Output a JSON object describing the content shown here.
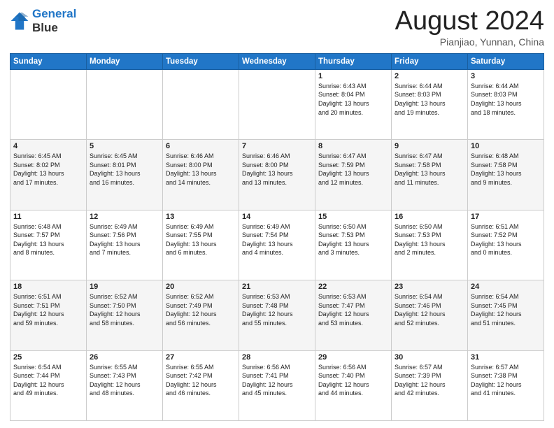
{
  "header": {
    "logo_line1": "General",
    "logo_line2": "Blue",
    "month": "August 2024",
    "location": "Pianjiao, Yunnan, China"
  },
  "weekdays": [
    "Sunday",
    "Monday",
    "Tuesday",
    "Wednesday",
    "Thursday",
    "Friday",
    "Saturday"
  ],
  "weeks": [
    [
      {
        "day": "",
        "info": ""
      },
      {
        "day": "",
        "info": ""
      },
      {
        "day": "",
        "info": ""
      },
      {
        "day": "",
        "info": ""
      },
      {
        "day": "1",
        "info": "Sunrise: 6:43 AM\nSunset: 8:04 PM\nDaylight: 13 hours\nand 20 minutes."
      },
      {
        "day": "2",
        "info": "Sunrise: 6:44 AM\nSunset: 8:03 PM\nDaylight: 13 hours\nand 19 minutes."
      },
      {
        "day": "3",
        "info": "Sunrise: 6:44 AM\nSunset: 8:03 PM\nDaylight: 13 hours\nand 18 minutes."
      }
    ],
    [
      {
        "day": "4",
        "info": "Sunrise: 6:45 AM\nSunset: 8:02 PM\nDaylight: 13 hours\nand 17 minutes."
      },
      {
        "day": "5",
        "info": "Sunrise: 6:45 AM\nSunset: 8:01 PM\nDaylight: 13 hours\nand 16 minutes."
      },
      {
        "day": "6",
        "info": "Sunrise: 6:46 AM\nSunset: 8:00 PM\nDaylight: 13 hours\nand 14 minutes."
      },
      {
        "day": "7",
        "info": "Sunrise: 6:46 AM\nSunset: 8:00 PM\nDaylight: 13 hours\nand 13 minutes."
      },
      {
        "day": "8",
        "info": "Sunrise: 6:47 AM\nSunset: 7:59 PM\nDaylight: 13 hours\nand 12 minutes."
      },
      {
        "day": "9",
        "info": "Sunrise: 6:47 AM\nSunset: 7:58 PM\nDaylight: 13 hours\nand 11 minutes."
      },
      {
        "day": "10",
        "info": "Sunrise: 6:48 AM\nSunset: 7:58 PM\nDaylight: 13 hours\nand 9 minutes."
      }
    ],
    [
      {
        "day": "11",
        "info": "Sunrise: 6:48 AM\nSunset: 7:57 PM\nDaylight: 13 hours\nand 8 minutes."
      },
      {
        "day": "12",
        "info": "Sunrise: 6:49 AM\nSunset: 7:56 PM\nDaylight: 13 hours\nand 7 minutes."
      },
      {
        "day": "13",
        "info": "Sunrise: 6:49 AM\nSunset: 7:55 PM\nDaylight: 13 hours\nand 6 minutes."
      },
      {
        "day": "14",
        "info": "Sunrise: 6:49 AM\nSunset: 7:54 PM\nDaylight: 13 hours\nand 4 minutes."
      },
      {
        "day": "15",
        "info": "Sunrise: 6:50 AM\nSunset: 7:53 PM\nDaylight: 13 hours\nand 3 minutes."
      },
      {
        "day": "16",
        "info": "Sunrise: 6:50 AM\nSunset: 7:53 PM\nDaylight: 13 hours\nand 2 minutes."
      },
      {
        "day": "17",
        "info": "Sunrise: 6:51 AM\nSunset: 7:52 PM\nDaylight: 13 hours\nand 0 minutes."
      }
    ],
    [
      {
        "day": "18",
        "info": "Sunrise: 6:51 AM\nSunset: 7:51 PM\nDaylight: 12 hours\nand 59 minutes."
      },
      {
        "day": "19",
        "info": "Sunrise: 6:52 AM\nSunset: 7:50 PM\nDaylight: 12 hours\nand 58 minutes."
      },
      {
        "day": "20",
        "info": "Sunrise: 6:52 AM\nSunset: 7:49 PM\nDaylight: 12 hours\nand 56 minutes."
      },
      {
        "day": "21",
        "info": "Sunrise: 6:53 AM\nSunset: 7:48 PM\nDaylight: 12 hours\nand 55 minutes."
      },
      {
        "day": "22",
        "info": "Sunrise: 6:53 AM\nSunset: 7:47 PM\nDaylight: 12 hours\nand 53 minutes."
      },
      {
        "day": "23",
        "info": "Sunrise: 6:54 AM\nSunset: 7:46 PM\nDaylight: 12 hours\nand 52 minutes."
      },
      {
        "day": "24",
        "info": "Sunrise: 6:54 AM\nSunset: 7:45 PM\nDaylight: 12 hours\nand 51 minutes."
      }
    ],
    [
      {
        "day": "25",
        "info": "Sunrise: 6:54 AM\nSunset: 7:44 PM\nDaylight: 12 hours\nand 49 minutes."
      },
      {
        "day": "26",
        "info": "Sunrise: 6:55 AM\nSunset: 7:43 PM\nDaylight: 12 hours\nand 48 minutes."
      },
      {
        "day": "27",
        "info": "Sunrise: 6:55 AM\nSunset: 7:42 PM\nDaylight: 12 hours\nand 46 minutes."
      },
      {
        "day": "28",
        "info": "Sunrise: 6:56 AM\nSunset: 7:41 PM\nDaylight: 12 hours\nand 45 minutes."
      },
      {
        "day": "29",
        "info": "Sunrise: 6:56 AM\nSunset: 7:40 PM\nDaylight: 12 hours\nand 44 minutes."
      },
      {
        "day": "30",
        "info": "Sunrise: 6:57 AM\nSunset: 7:39 PM\nDaylight: 12 hours\nand 42 minutes."
      },
      {
        "day": "31",
        "info": "Sunrise: 6:57 AM\nSunset: 7:38 PM\nDaylight: 12 hours\nand 41 minutes."
      }
    ]
  ]
}
